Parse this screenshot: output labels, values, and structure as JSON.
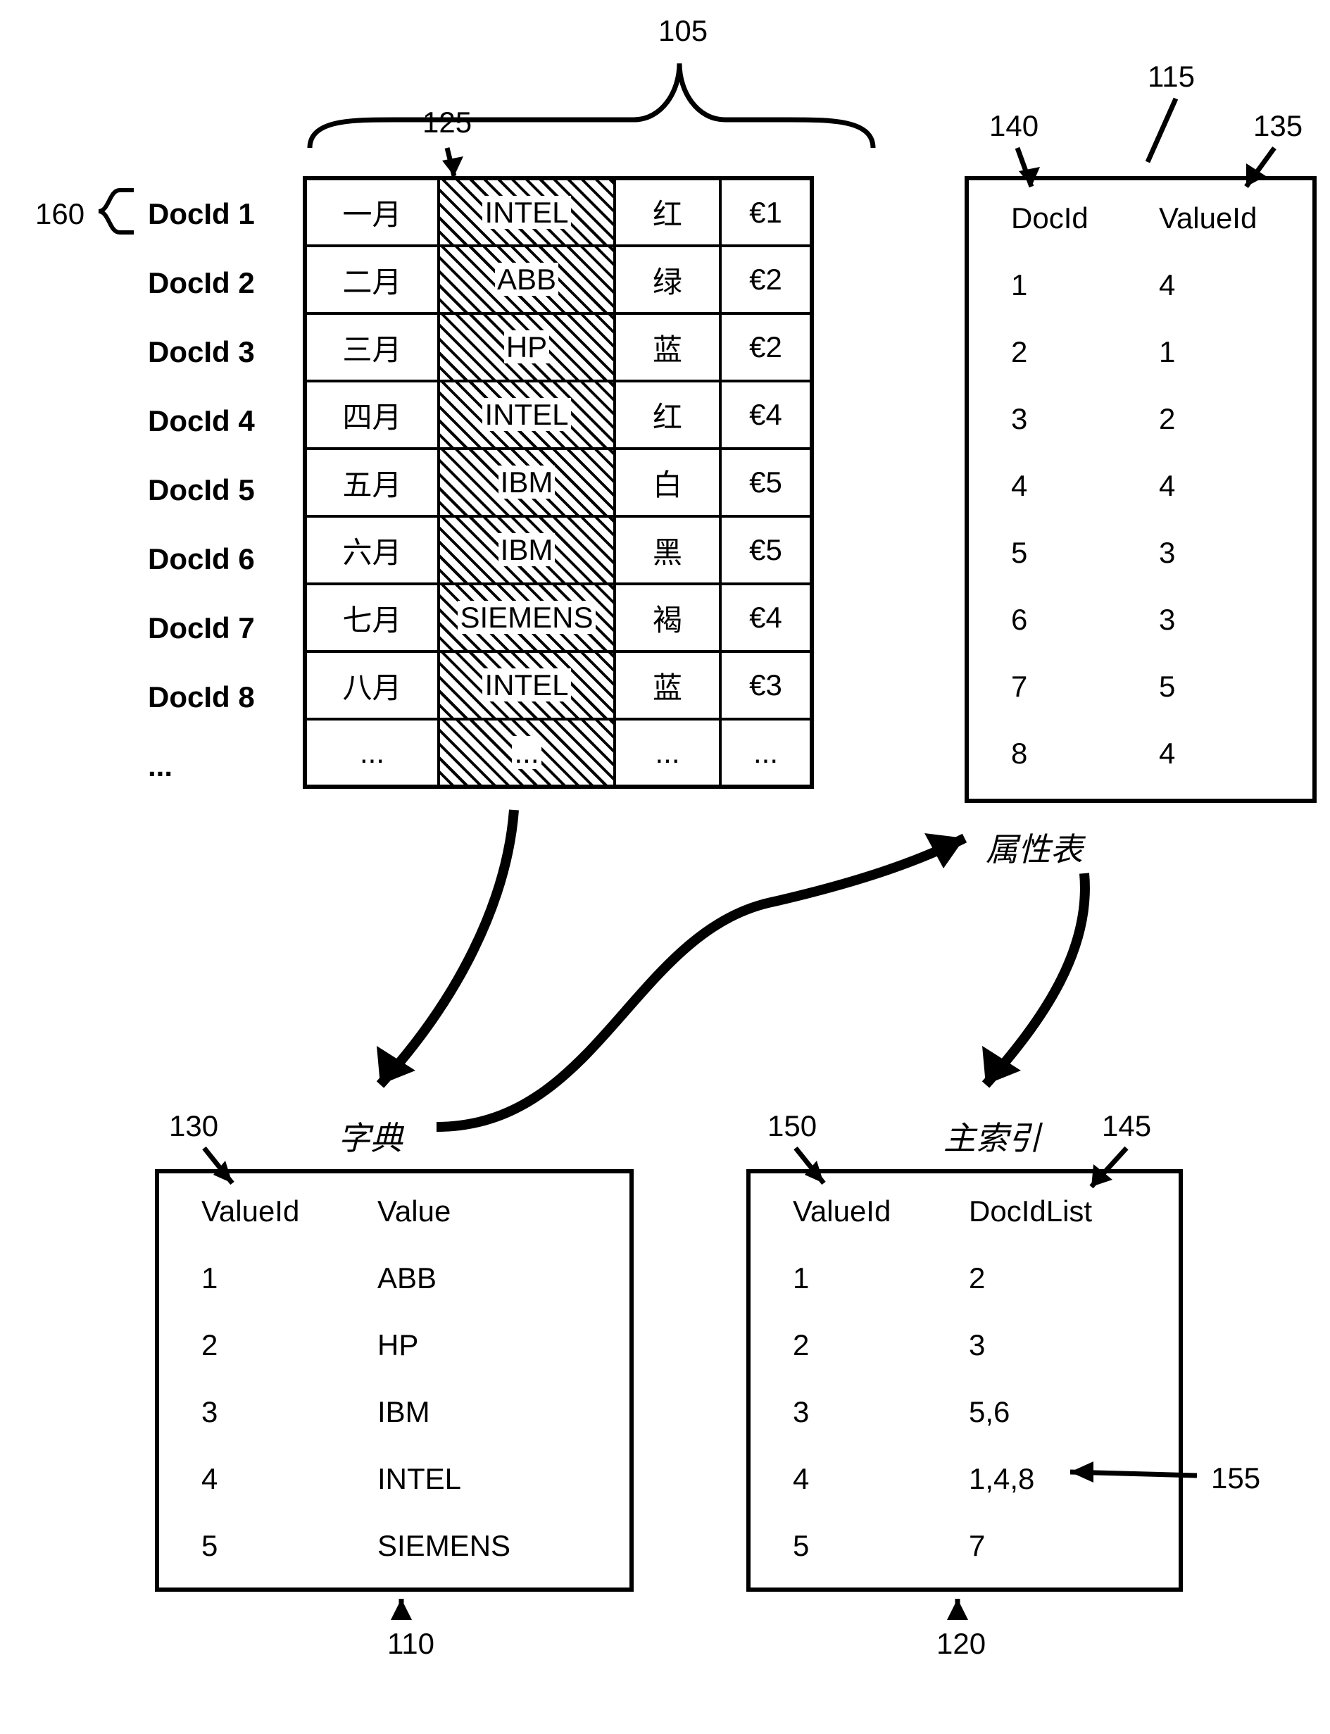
{
  "refs": {
    "r105": "105",
    "r115": "115",
    "r125": "125",
    "r130": "130",
    "r135": "135",
    "r140": "140",
    "r145": "145",
    "r150": "150",
    "r155": "155",
    "r160": "160",
    "r110": "110",
    "r120": "120"
  },
  "docids": {
    "d1": "DocId 1",
    "d2": "DocId 2",
    "d3": "DocId 3",
    "d4": "DocId 4",
    "d5": "DocId 5",
    "d6": "DocId 6",
    "d7": "DocId 7",
    "d8": "DocId 8",
    "ddots": "..."
  },
  "docTable": {
    "r1": {
      "month": "一月",
      "company": "INTEL",
      "color": "红",
      "amount": "€1"
    },
    "r2": {
      "month": "二月",
      "company": "ABB",
      "color": "绿",
      "amount": "€2"
    },
    "r3": {
      "month": "三月",
      "company": "HP",
      "color": "蓝",
      "amount": "€2"
    },
    "r4": {
      "month": "四月",
      "company": "INTEL",
      "color": "红",
      "amount": "€4"
    },
    "r5": {
      "month": "五月",
      "company": "IBM",
      "color": "白",
      "amount": "€5"
    },
    "r6": {
      "month": "六月",
      "company": "IBM",
      "color": "黑",
      "amount": "€5"
    },
    "r7": {
      "month": "七月",
      "company": "SIEMENS",
      "color": "褐",
      "amount": "€4"
    },
    "r8": {
      "month": "八月",
      "company": "INTEL",
      "color": "蓝",
      "amount": "€3"
    },
    "r9": {
      "month": "...",
      "company": "...",
      "color": "...",
      "amount": "..."
    }
  },
  "attrTable": {
    "hdr": {
      "docid": "DocId",
      "valueid": "ValueId"
    },
    "rows": {
      "r1": {
        "d": "1",
        "v": "4"
      },
      "r2": {
        "d": "2",
        "v": "1"
      },
      "r3": {
        "d": "3",
        "v": "2"
      },
      "r4": {
        "d": "4",
        "v": "4"
      },
      "r5": {
        "d": "5",
        "v": "3"
      },
      "r6": {
        "d": "6",
        "v": "3"
      },
      "r7": {
        "d": "7",
        "v": "5"
      },
      "r8": {
        "d": "8",
        "v": "4"
      }
    }
  },
  "dict": {
    "hdr": {
      "valueid": "ValueId",
      "value": "Value"
    },
    "rows": {
      "r1": {
        "id": "1",
        "val": "ABB"
      },
      "r2": {
        "id": "2",
        "val": "HP"
      },
      "r3": {
        "id": "3",
        "val": "IBM"
      },
      "r4": {
        "id": "4",
        "val": "INTEL"
      },
      "r5": {
        "id": "5",
        "val": "SIEMENS"
      }
    }
  },
  "mainIndex": {
    "hdr": {
      "valueid": "ValueId",
      "list": "DocIdList"
    },
    "rows": {
      "r1": {
        "id": "1",
        "list": "2"
      },
      "r2": {
        "id": "2",
        "list": "3"
      },
      "r3": {
        "id": "3",
        "list": "5,6"
      },
      "r4": {
        "id": "4",
        "list": "1,4,8"
      },
      "r5": {
        "id": "5",
        "list": "7"
      }
    }
  },
  "cnLabels": {
    "attr": "属性表",
    "dict": "字典",
    "main": "主索引"
  }
}
